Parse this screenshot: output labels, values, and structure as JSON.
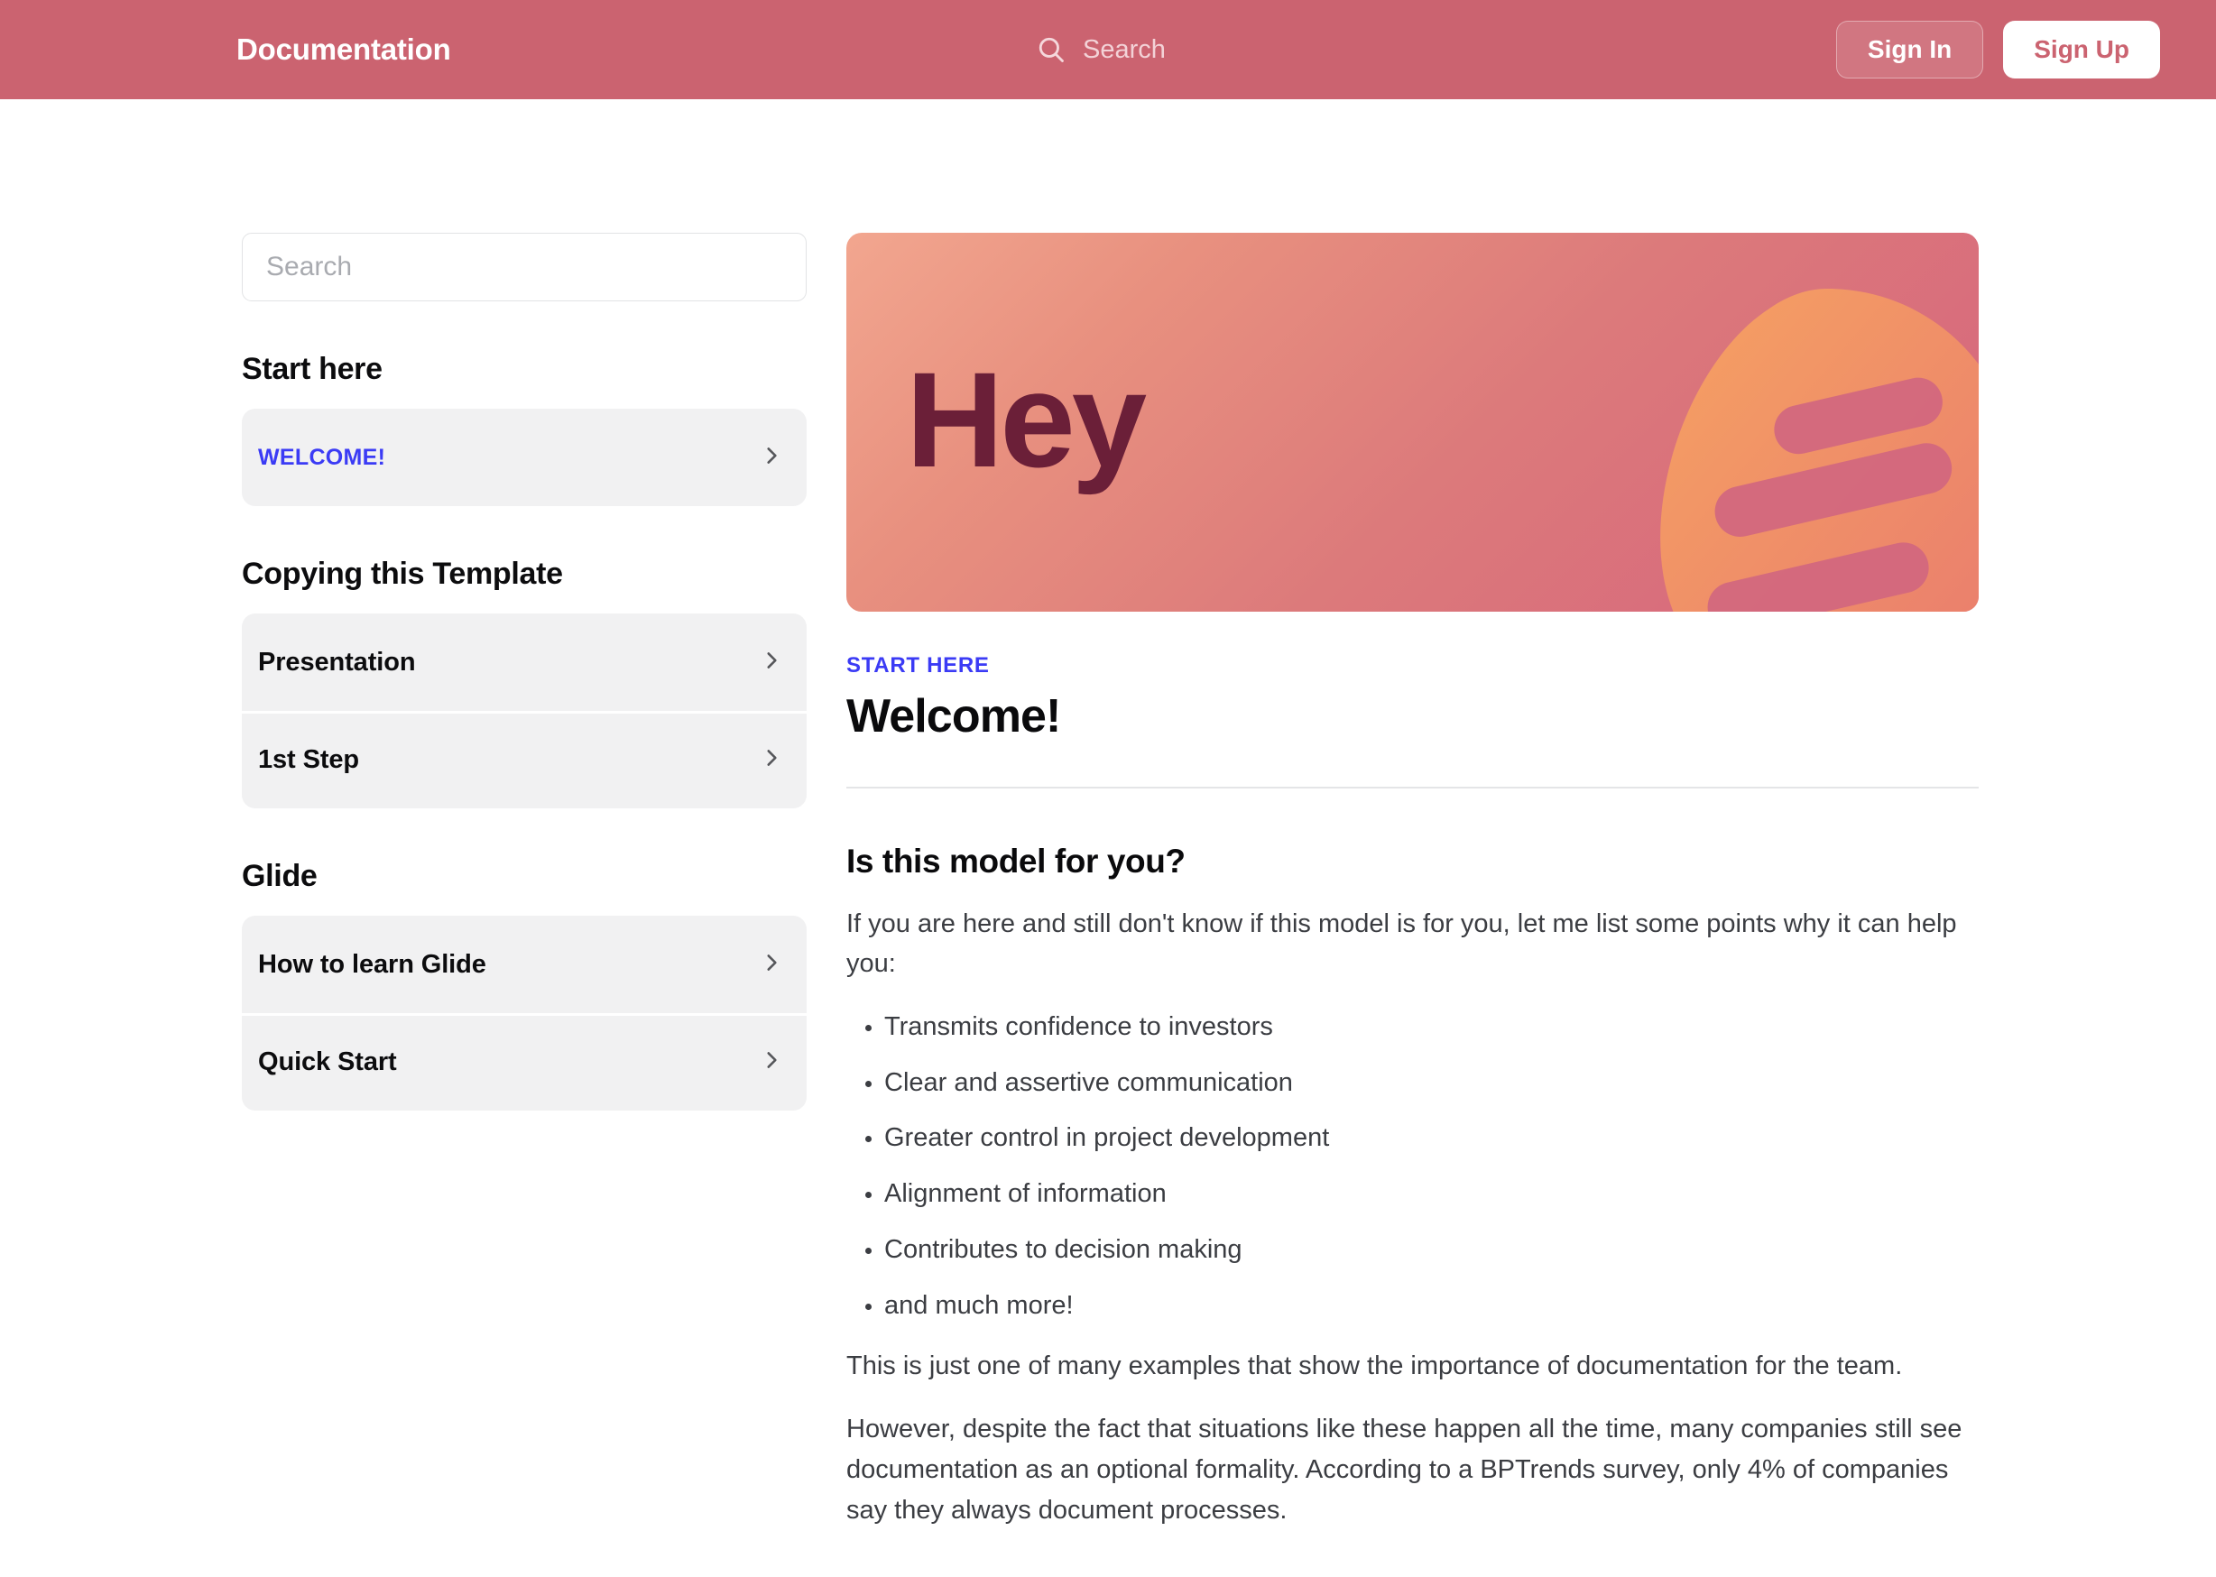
{
  "header": {
    "brand": "Documentation",
    "search_label": "Search",
    "search_icon": "search-icon",
    "sign_in": "Sign In",
    "sign_up": "Sign Up",
    "bg_color": "#cb6370",
    "sign_up_text_color": "#cb6370"
  },
  "sidebar": {
    "search_placeholder": "Search",
    "sections": [
      {
        "title": "Start here",
        "items": [
          {
            "label": "WELCOME!",
            "accent": true,
            "chevron": "chevron-right-icon"
          }
        ]
      },
      {
        "title": "Copying this Template",
        "items": [
          {
            "label": "Presentation",
            "accent": false,
            "chevron": "chevron-right-icon"
          },
          {
            "label": "1st Step",
            "accent": false,
            "chevron": "chevron-right-icon"
          }
        ]
      },
      {
        "title": "Glide",
        "items": [
          {
            "label": "How to learn Glide",
            "accent": false,
            "chevron": "chevron-right-icon"
          },
          {
            "label": "Quick Start",
            "accent": false,
            "chevron": "chevron-right-icon"
          }
        ]
      }
    ]
  },
  "main": {
    "hero": {
      "word": "Hey",
      "word_color": "#6b1f38",
      "gradient_from": "#f2a68f",
      "gradient_to": "#d6647c",
      "art_color": "#f2945f"
    },
    "eyebrow": "START HERE",
    "eyebrow_color": "#3b3bf5",
    "title": "Welcome!",
    "section_heading": "Is this model for you?",
    "intro": "If you are here and still don't know if this model is for you, let me list some points why it can help you:",
    "bullets": [
      "Transmits confidence to investors",
      "Clear and assertive communication",
      "Greater control in project development",
      "Alignment of information",
      "Contributes to decision making",
      "and much more!"
    ],
    "paragraph_1": "This is just one of many examples that show the importance of documentation for the team.",
    "paragraph_2": "However, despite the fact that situations like these happen all the time, many companies still see documentation as an optional formality. According to a BPTrends survey, only 4% of companies say they always document processes."
  }
}
